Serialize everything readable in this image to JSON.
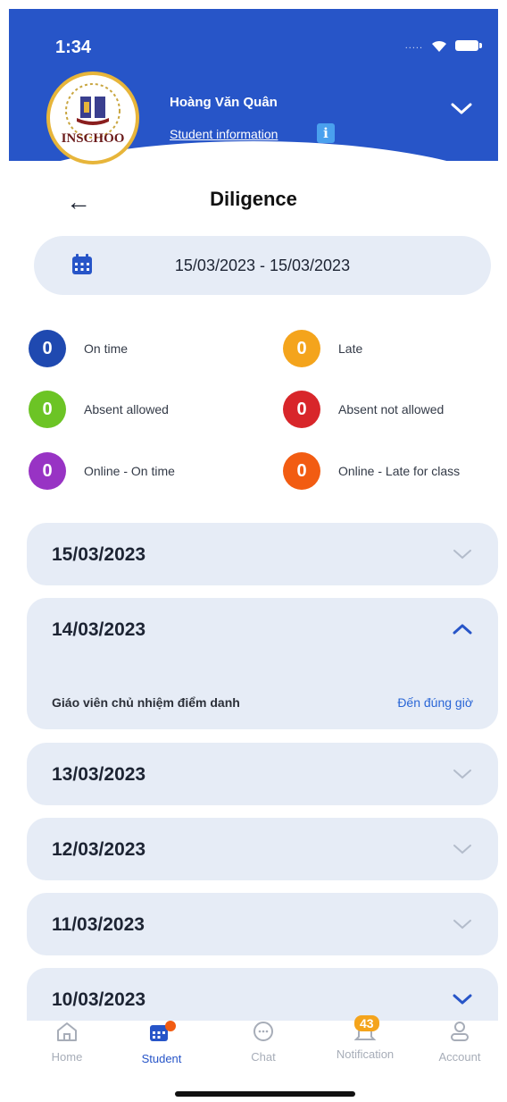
{
  "status_bar": {
    "time": "1:34"
  },
  "header": {
    "logo_text": "INSCHOO",
    "student_name": "Hoàng Văn Quân",
    "student_info_link": "Student information",
    "info_icon_glyph": "i"
  },
  "page": {
    "title": "Diligence"
  },
  "date_range": {
    "value": "15/03/2023 - 15/03/2023"
  },
  "summary": [
    {
      "count": "0",
      "label": "On time",
      "color": "#1f49b0"
    },
    {
      "count": "0",
      "label": "Late",
      "color": "#f4a41c"
    },
    {
      "count": "0",
      "label": "Absent allowed",
      "color": "#6cc425"
    },
    {
      "count": "0",
      "label": "Absent not allowed",
      "color": "#d8262a"
    },
    {
      "count": "0",
      "label": "Online - On time",
      "color": "#9833c4"
    },
    {
      "count": "0",
      "label": "Online - Late for class",
      "color": "#f25c12"
    }
  ],
  "days": [
    {
      "date": "15/03/2023",
      "expanded": false
    },
    {
      "date": "14/03/2023",
      "expanded": true,
      "detail_label": "Giáo viên chủ nhiệm điểm danh",
      "detail_value": "Đến đúng giờ"
    },
    {
      "date": "13/03/2023",
      "expanded": false
    },
    {
      "date": "12/03/2023",
      "expanded": false
    },
    {
      "date": "11/03/2023",
      "expanded": false
    },
    {
      "date": "10/03/2023",
      "expanded": false
    }
  ],
  "bottom_nav": {
    "home": "Home",
    "student": "Student",
    "chat": "Chat",
    "notification": "Notification",
    "notification_badge": "43",
    "account": "Account"
  },
  "colors": {
    "primary": "#2755c8",
    "card": "#e6ecf6",
    "link": "#2a66d6",
    "student_dot": "#f25c12",
    "badge": "#f4a41c"
  }
}
